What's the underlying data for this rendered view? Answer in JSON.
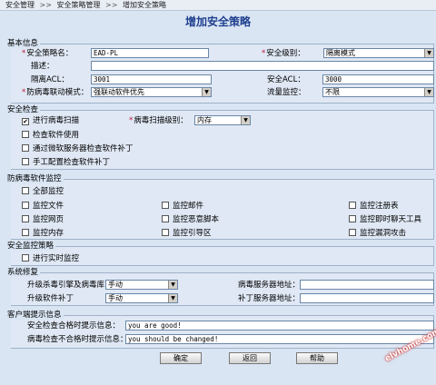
{
  "breadcrumb": {
    "sep": ">>",
    "items": [
      "安全管理",
      "安全策略管理",
      "增加安全策略"
    ]
  },
  "title": "增加安全策略",
  "basic": {
    "legend": "基本信息",
    "policy_name_label": "安全策略名：",
    "policy_name_value": "EAD-PL",
    "security_level_label": "安全级别：",
    "security_level_value": "隔离模式",
    "description_label": "描述：",
    "description_value": "",
    "quarantine_acl_label": "隔离ACL：",
    "quarantine_acl_value": "3001",
    "secure_acl_label": "安全ACL：",
    "secure_acl_value": "3000",
    "av_mode_label": "防病毒联动模式：",
    "av_mode_value": "强联动软件优先",
    "traffic_label": "流量监控：",
    "traffic_value": "不限"
  },
  "check": {
    "legend": "安全检查",
    "virus_scan_label": "进行病毒扫描",
    "virus_scan_checked": true,
    "scan_level_label": "病毒扫描级别：",
    "scan_level_value": "内存",
    "check_software_label": "检查软件使用",
    "patch_ms_label": "通过微软服务器检查软件补丁",
    "patch_manual_label": "手工配置检查软件补丁"
  },
  "av": {
    "legend": "防病毒软件监控",
    "items": [
      "全部监控",
      "监控文件",
      "监控邮件",
      "监控注册表",
      "监控网页",
      "监控恶意脚本",
      "监控即时聊天工具",
      "监控内存",
      "监控引导区",
      "监控漏洞攻击"
    ]
  },
  "monitor": {
    "legend": "安全监控策略",
    "realtime_label": "进行实时监控"
  },
  "repair": {
    "legend": "系统修复",
    "upgrade_engine_label": "升级杀毒引擎及病毒库",
    "upgrade_engine_value": "手动",
    "av_server_label": "病毒服务器地址：",
    "av_server_value": "",
    "upgrade_patch_label": "升级软件补丁",
    "upgrade_patch_value": "手动",
    "patch_server_label": "补丁服务器地址：",
    "patch_server_value": ""
  },
  "client": {
    "legend": "客户端提示信息",
    "pass_label": "安全检查合格时提示信息：",
    "pass_value": "you are good!",
    "fail_label": "病毒检查不合格时提示信息：",
    "fail_value": "you should be changed!"
  },
  "buttons": {
    "ok": "确定",
    "back": "返回",
    "help": "帮助"
  },
  "watermark": "elvhome.com",
  "icons": {
    "checked": "checkmark-icon",
    "arrow": "chevron-down-icon"
  }
}
